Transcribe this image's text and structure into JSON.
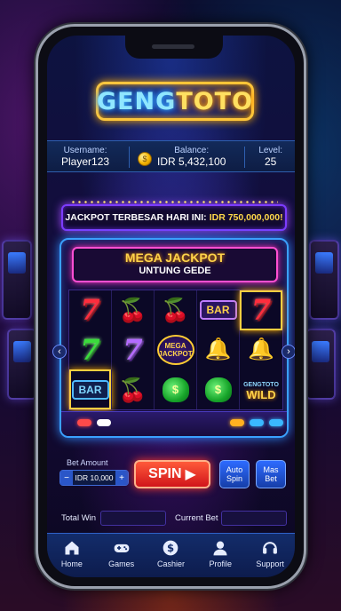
{
  "brand": {
    "logo_part1": "GENG",
    "logo_part2": "TOTO"
  },
  "stats": {
    "username_label": "Username:",
    "username": "Player123",
    "balance_label": "Balance:",
    "balance": "IDR 5,432,100",
    "level_label": "Level:",
    "level": "25"
  },
  "jackpot": {
    "label": "JACKPOT TERBESAR HARI INI:",
    "amount": "IDR 750,000,000!"
  },
  "machine": {
    "title": "MEGA JACKPOT",
    "subtitle": "UNTUNG GEDE",
    "mega_symbol": [
      "MEGA",
      "JACKPOT"
    ],
    "wild_symbol": [
      "GENGTOTO",
      "WILD"
    ],
    "bar_label": "BAR",
    "seven_label": "7",
    "money_label": "$"
  },
  "controls": {
    "bet_amount_label": "Bet Amount",
    "bet_value": "IDR 10,000",
    "minus": "−",
    "plus": "+",
    "spin_label": "SPIN",
    "spin_arrow": "▶",
    "auto_spin_label": "Auto Spin",
    "max_bet_label": "Mas Bet"
  },
  "totals": {
    "total_win_label": "Total Win",
    "total_win_value": "",
    "current_bet_label": "Current Bet",
    "current_bet_value": ""
  },
  "nav": [
    {
      "label": "Home",
      "icon": "home-icon"
    },
    {
      "label": "Games",
      "icon": "gamepad-icon"
    },
    {
      "label": "Cashier",
      "icon": "dollar-icon"
    },
    {
      "label": "Profile",
      "icon": "user-icon"
    },
    {
      "label": "Support",
      "icon": "headset-icon"
    }
  ],
  "colors": {
    "logo_border": "#ffc83a",
    "spin": "#e02020",
    "accent_blue": "#3aa0ff",
    "accent_pink": "#ff4fd2"
  }
}
